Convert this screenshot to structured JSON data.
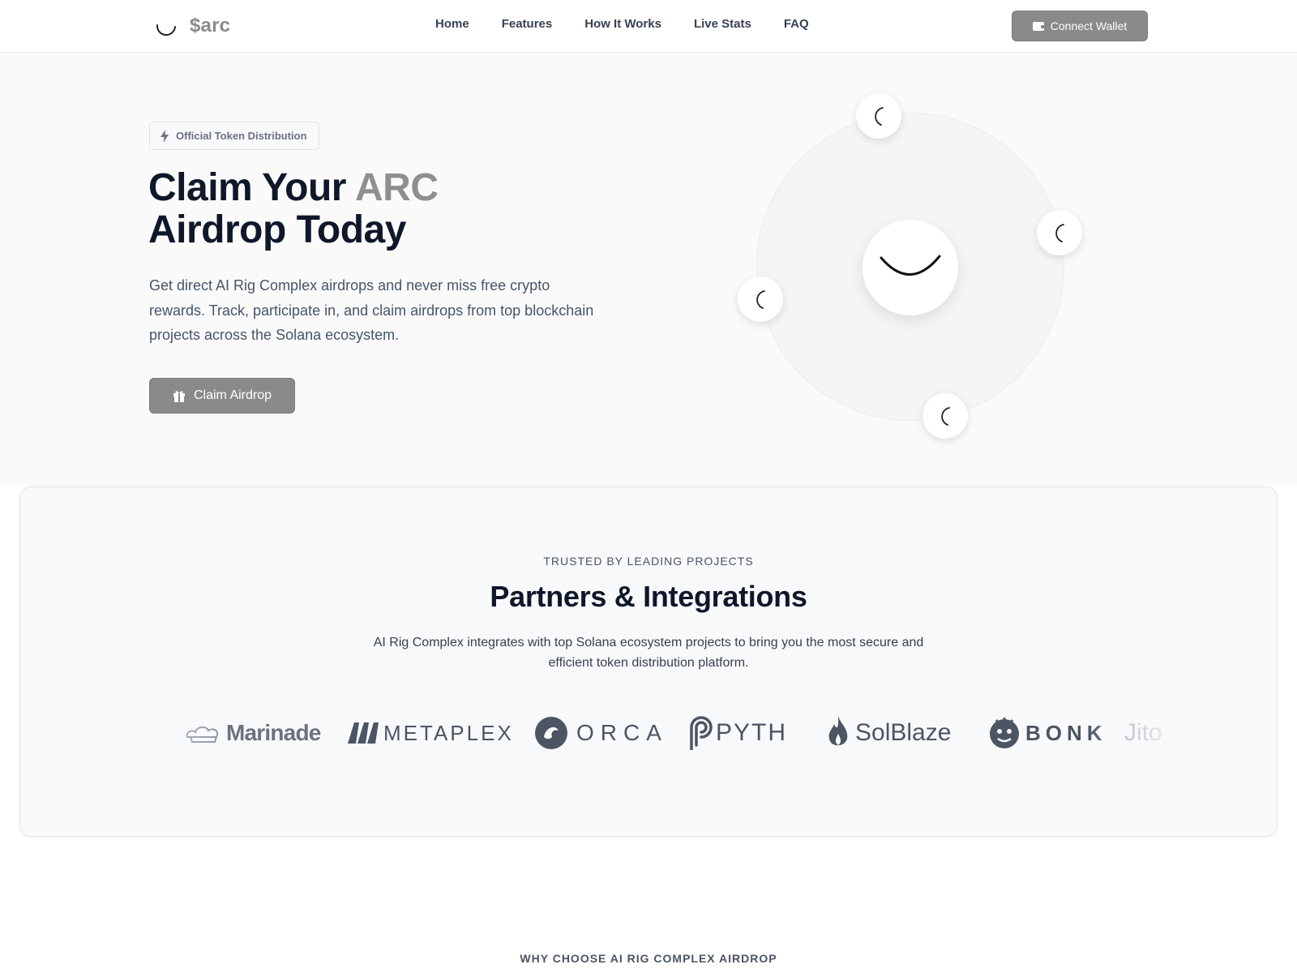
{
  "nav": {
    "brand": "$arc",
    "links": [
      "Home",
      "Features",
      "How It Works",
      "Live Stats",
      "FAQ"
    ],
    "connect_label": "Connect Wallet"
  },
  "hero": {
    "badge": "Official Token Distribution",
    "title_prefix": "Claim Your ",
    "title_accent": "ARC",
    "title_line2": "Airdrop Today",
    "description": "Get direct AI Rig Complex airdrops and never miss free crypto rewards. Track, participate in, and claim airdrops from top blockchain projects across the Solana ecosystem.",
    "claim_label": "Claim Airdrop"
  },
  "partners": {
    "eyebrow": "TRUSTED BY LEADING PROJECTS",
    "title": "Partners & Integrations",
    "description": "AI Rig Complex integrates with top Solana ecosystem projects to bring you the most secure and efficient token distribution platform.",
    "logos": [
      "Marinade",
      "METAPLEX",
      "ORCA",
      "PYTH",
      "SolBlaze",
      "BONK",
      "Jito"
    ]
  },
  "why": {
    "eyebrow": "WHY CHOOSE AI RIG COMPLEX AIRDROP"
  },
  "colors": {
    "accent_gray": "#8a8a8a",
    "heading": "#0f172a",
    "body_text": "#475569"
  },
  "icons": [
    "arc-logo-icon",
    "wallet-icon",
    "bolt-icon",
    "gift-icon",
    "smile-arc-icon",
    "spinner-icon"
  ]
}
